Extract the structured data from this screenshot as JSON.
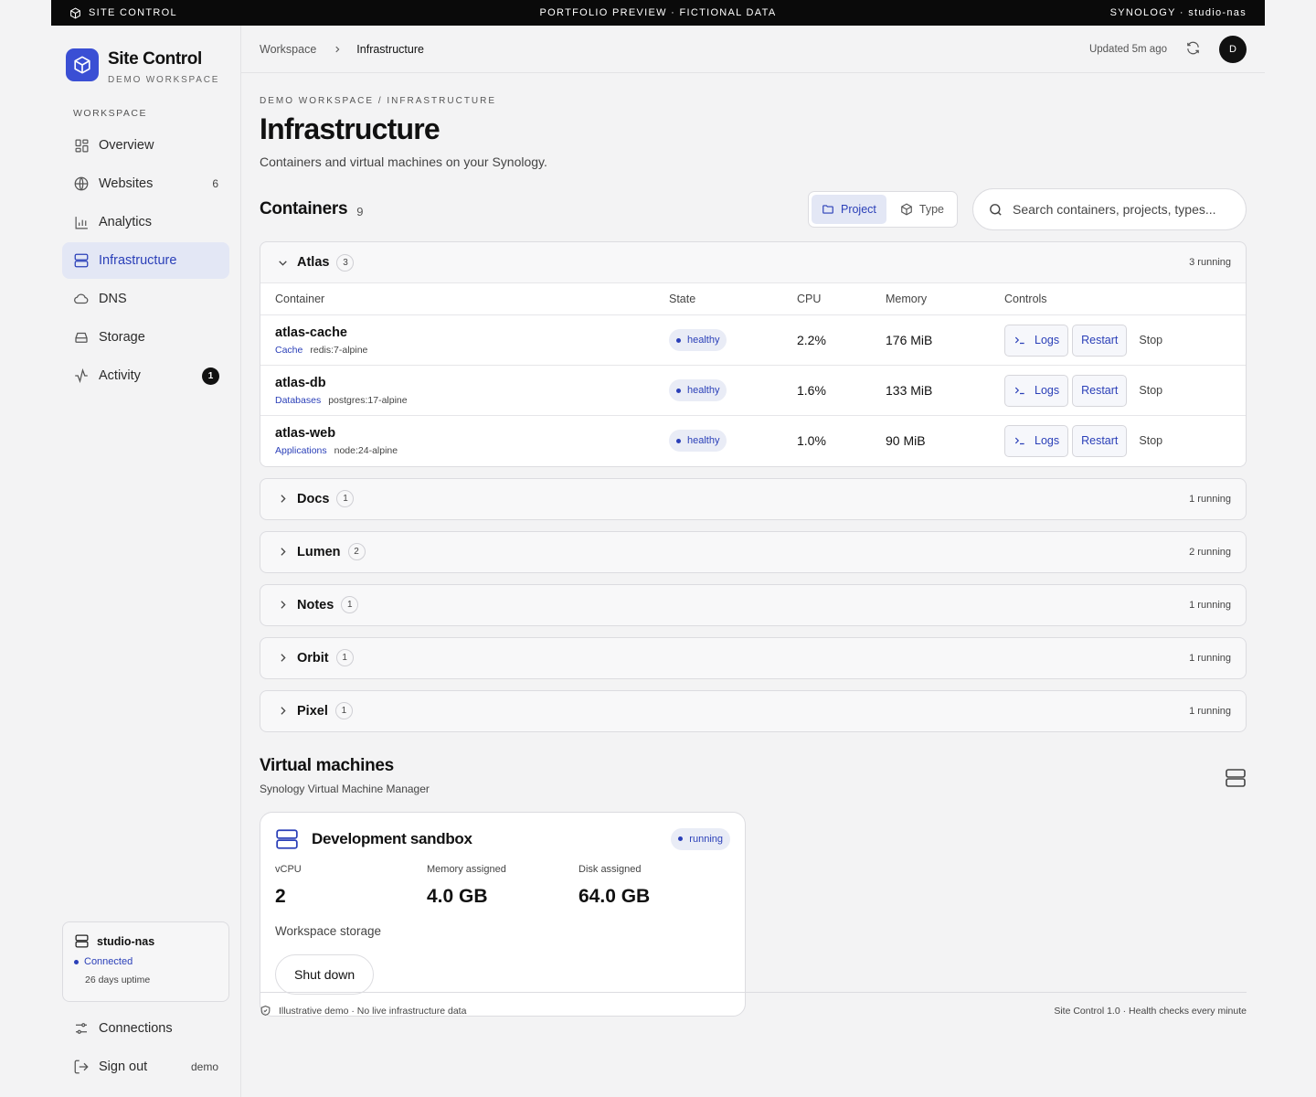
{
  "topbar": {
    "brand": "SITE CONTROL",
    "center": "PORTFOLIO PREVIEW · FICTIONAL DATA",
    "right": "SYNOLOGY · studio-nas"
  },
  "sidebar": {
    "title": "Site Control",
    "subtitle": "DEMO WORKSPACE",
    "section": "WORKSPACE",
    "items": [
      {
        "label": "Overview",
        "icon": "grid-icon"
      },
      {
        "label": "Websites",
        "icon": "globe-icon",
        "count": "6"
      },
      {
        "label": "Analytics",
        "icon": "bar-chart-icon"
      },
      {
        "label": "Infrastructure",
        "icon": "server-icon",
        "active": true
      },
      {
        "label": "DNS",
        "icon": "cloud-icon"
      },
      {
        "label": "Storage",
        "icon": "drive-icon"
      },
      {
        "label": "Activity",
        "icon": "pulse-icon",
        "badge": "1"
      }
    ],
    "nas": {
      "name": "studio-nas",
      "status": "Connected",
      "uptime": "26 days uptime"
    },
    "bottom": [
      {
        "label": "Connections",
        "icon": "sliders-icon"
      },
      {
        "label": "Sign out",
        "icon": "sign-out-icon",
        "meta": "demo"
      }
    ]
  },
  "header": {
    "crumbs": [
      "Workspace",
      "Infrastructure"
    ],
    "updated": "Updated 5m ago",
    "avatar": "D"
  },
  "page": {
    "overline": "DEMO WORKSPACE / INFRASTRUCTURE",
    "title": "Infrastructure",
    "description": "Containers and virtual machines on your Synology."
  },
  "containers": {
    "title": "Containers",
    "count": "9",
    "group_by": [
      "Project",
      "Type"
    ],
    "search_placeholder": "Search containers, projects, types...",
    "columns": [
      "Container",
      "State",
      "CPU",
      "Memory",
      "Controls"
    ],
    "controls": [
      "Logs",
      "Restart",
      "Stop"
    ],
    "groups": [
      {
        "name": "Atlas",
        "count": "3",
        "running": "3 running",
        "expanded": true,
        "rows": [
          {
            "name": "atlas-cache",
            "category": "Cache",
            "image": "redis:7-alpine",
            "state": "healthy",
            "cpu": "2.2%",
            "memory": "176 MiB"
          },
          {
            "name": "atlas-db",
            "category": "Databases",
            "image": "postgres:17-alpine",
            "state": "healthy",
            "cpu": "1.6%",
            "memory": "133 MiB"
          },
          {
            "name": "atlas-web",
            "category": "Applications",
            "image": "node:24-alpine",
            "state": "healthy",
            "cpu": "1.0%",
            "memory": "90 MiB"
          }
        ]
      },
      {
        "name": "Docs",
        "count": "1",
        "running": "1 running"
      },
      {
        "name": "Lumen",
        "count": "2",
        "running": "2 running"
      },
      {
        "name": "Notes",
        "count": "1",
        "running": "1 running"
      },
      {
        "name": "Orbit",
        "count": "1",
        "running": "1 running"
      },
      {
        "name": "Pixel",
        "count": "1",
        "running": "1 running"
      }
    ]
  },
  "vms": {
    "title": "Virtual machines",
    "subtitle": "Synology Virtual Machine Manager",
    "card": {
      "name": "Development sandbox",
      "state": "running",
      "stats": [
        {
          "label": "vCPU",
          "value": "2"
        },
        {
          "label": "Memory assigned",
          "value": "4.0 GB"
        },
        {
          "label": "Disk assigned",
          "value": "64.0 GB"
        }
      ],
      "storage": "Workspace storage",
      "action": "Shut down"
    }
  },
  "footer": {
    "left": "Illustrative demo · No live infrastructure data",
    "right": "Site Control 1.0 · Health checks every minute"
  },
  "colors": {
    "accent": "#2a3fb8",
    "brand": "#3a4fd4",
    "badge_bg": "#e9ecf6",
    "active_bg": "#e3e7f5"
  }
}
